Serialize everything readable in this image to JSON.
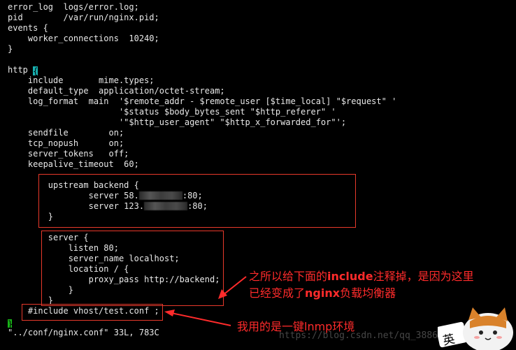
{
  "terminal": {
    "lines": [
      "error_log  logs/error.log;",
      "pid        /var/run/nginx.pid;",
      "events {",
      "    worker_connections  10240;",
      "}",
      "",
      "http ",
      "    include       mime.types;",
      "    default_type  application/octet-stream;",
      "    log_format  main  '$remote_addr - $remote_user [$time_local] \"$request\" '",
      "                      '$status $body_bytes_sent \"$http_referer\" '",
      "                      '\"$http_user_agent\" \"$http_x_forwarded_for\"';",
      "    sendfile        on;",
      "    tcp_nopush      on;",
      "    server_tokens   off;",
      "    keepalive_timeout  60;",
      "",
      "        upstream backend {",
      "                server 58.",
      "                server 123.",
      "        }",
      "",
      "        server {",
      "            listen 80;",
      "            server_name localhost;",
      "            location / {",
      "                proxy_pass http://backend;",
      "            }",
      "        }",
      "    #include vhost/test.conf ;",
      "",
      "\"../conf/nginx.conf\" 33L, 783C"
    ],
    "http_cursor_char": "{",
    "upstream_port_suffix": ":80;",
    "closing_brace_line": "}"
  },
  "annotations": {
    "include_note_line1_pre": "之所以给下面的",
    "include_note_line1_word": "include",
    "include_note_line1_post": "注释掉，是因为这里",
    "include_note_line2_pre": "已经变成了",
    "include_note_line2_word": "nginx",
    "include_note_line2_post": "负载均衡器",
    "lnmp_note": "我用的是一键lnmp环境"
  },
  "watermark": {
    "text": "https://blog.csdn.net/qq_38862641"
  },
  "sticker": {
    "label": "英"
  },
  "colors": {
    "background": "#000000",
    "text": "#e8e8e8",
    "highlight_box": "#e8392b",
    "annotation_red": "#ff2b2b",
    "cursor_cyan": "#18b2b2",
    "cursor_green": "#18b218"
  }
}
